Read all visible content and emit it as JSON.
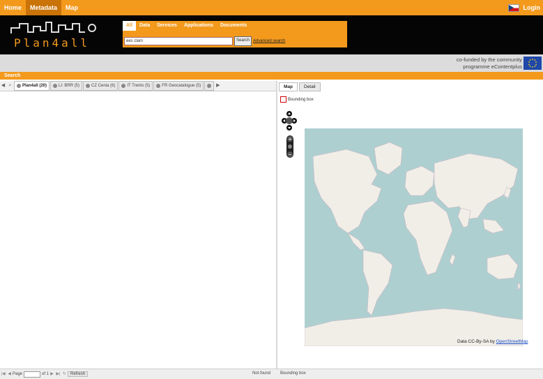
{
  "topnav": {
    "items": [
      {
        "label": "Home"
      },
      {
        "label": "Metadata"
      },
      {
        "label": "Map"
      }
    ],
    "active_index": 1,
    "login_label": "Login"
  },
  "header": {
    "logo_text": "Plan4all"
  },
  "search_box": {
    "tabs": [
      "All",
      "Data",
      "Services",
      "Applications",
      "Documents"
    ],
    "active_tab": 0,
    "query_value": "ees clam",
    "search_button": "Search",
    "advanced_link": "Advanced search"
  },
  "eu_band": {
    "line1": "co-funded by the community",
    "line2": "programme eContentplus"
  },
  "search_section": {
    "title": "Search"
  },
  "results_tabs": [
    {
      "label": "Plan4all (20)",
      "active": true
    },
    {
      "label": "LI: BRR (5)",
      "active": false
    },
    {
      "label": "CZ Cenia (6)",
      "active": false
    },
    {
      "label": "IT Trento (5)",
      "active": false
    },
    {
      "label": "FR Geocatalogue (5)",
      "active": false
    }
  ],
  "right_panel": {
    "tabs": [
      "Map",
      "Detail"
    ],
    "active_tab": 0,
    "bbox_label": "Bounding box"
  },
  "map": {
    "attribution_prefix": "Data CC-By-SA by",
    "attribution_link": "OpenStreetMap",
    "ocean_color": "#aecfd0",
    "land_color": "#f1eee8"
  },
  "bottom_bar": {
    "page_label": "Page",
    "of_label": "of 1",
    "refresh_label": "Refresh",
    "status_left": "Not found",
    "status_right": "Bounding box"
  }
}
